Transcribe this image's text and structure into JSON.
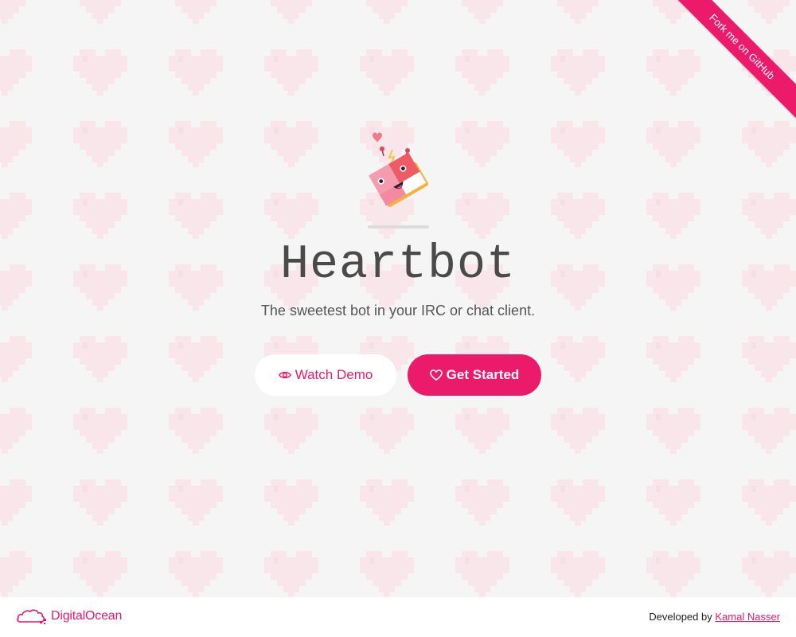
{
  "ribbon": {
    "label": "Fork me on GitHub"
  },
  "hero": {
    "title": "Heartbot",
    "tagline": "The sweetest bot in your IRC or chat client."
  },
  "buttons": {
    "watch_demo": "Watch Demo",
    "get_started": "Get Started"
  },
  "footer": {
    "sponsor": "DigitalOcean",
    "developed_by": "Developed by",
    "author": "Kamal Nasser"
  },
  "icons": {
    "eye": "eye-icon",
    "heart": "heart-icon",
    "cloud": "digitalocean-cloud-icon",
    "mascot": "heartbot-mascot"
  },
  "colors": {
    "accent": "#ec1a6a",
    "background": "#f6f5f6",
    "background_heart": "#f8e6ea",
    "title": "#4a4a4a",
    "tagline": "#555555",
    "divider": "#dcdcdc"
  }
}
